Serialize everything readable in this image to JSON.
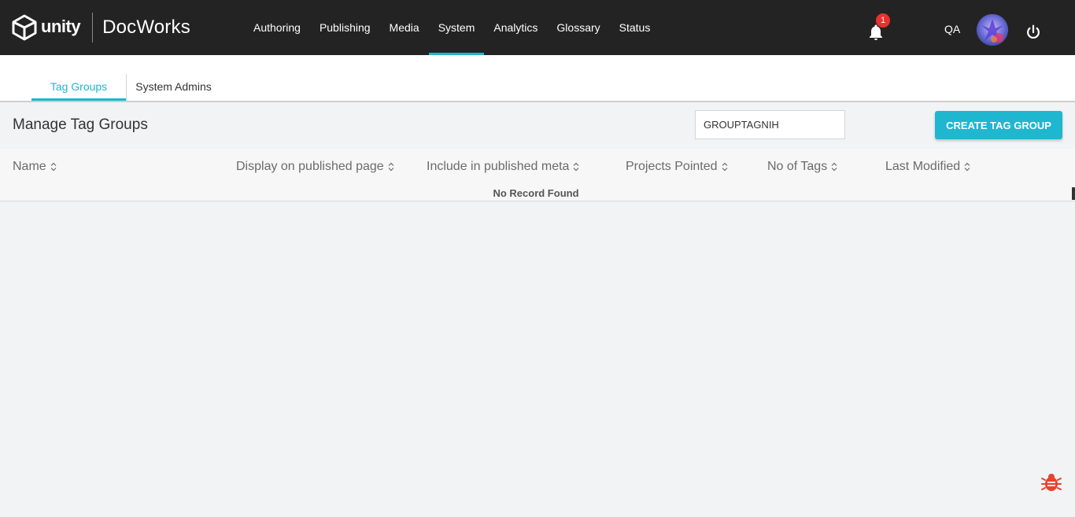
{
  "header": {
    "logo_text": "unity",
    "product_name": "DocWorks",
    "nav": [
      {
        "label": "Authoring"
      },
      {
        "label": "Publishing"
      },
      {
        "label": "Media"
      },
      {
        "label": "System"
      },
      {
        "label": "Analytics"
      },
      {
        "label": "Glossary"
      },
      {
        "label": "Status"
      }
    ],
    "active_nav": "System",
    "notification_count": "1",
    "user_initials": "QA"
  },
  "subtabs": {
    "tag_groups": "Tag Groups",
    "system_admins": "System Admins",
    "active": "Tag Groups"
  },
  "main": {
    "title": "Manage Tag Groups",
    "search_value": "GROUPTAGNIH",
    "create_button": "CREATE TAG GROUP",
    "columns": [
      {
        "label": "Name"
      },
      {
        "label": "Display on published page"
      },
      {
        "label": "Include in published meta"
      },
      {
        "label": "Projects Pointed"
      },
      {
        "label": "No of Tags"
      },
      {
        "label": "Last Modified"
      }
    ],
    "rows": [],
    "empty_message": "No Record Found"
  },
  "colors": {
    "accent": "#1fb6d0",
    "topbar": "#232323",
    "badge": "#e8322f",
    "bug": "#e8432f"
  }
}
